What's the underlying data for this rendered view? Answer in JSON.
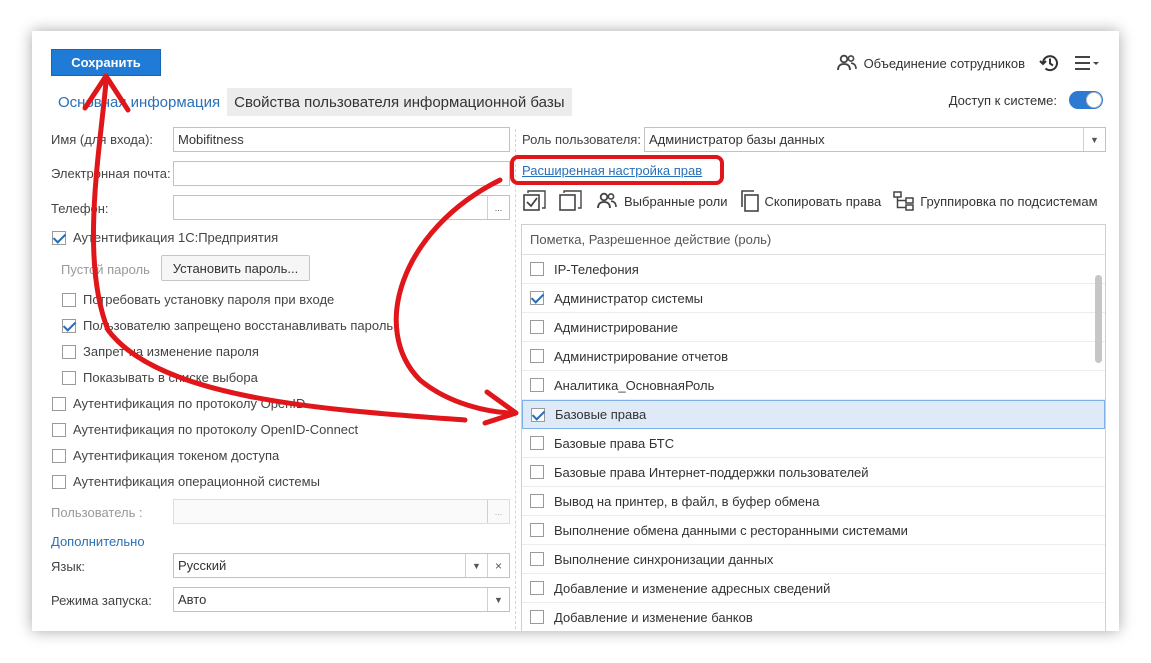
{
  "header": {
    "save_label": "Сохранить",
    "merge_label": "Объединение сотрудников",
    "merge_icon": "people-icon",
    "history_icon": "history-icon",
    "menu_icon": "hamburger-menu-icon"
  },
  "tabs": [
    {
      "label": "Основная информация",
      "active": false
    },
    {
      "label": "Свойства пользователя информационной базы",
      "active": true
    }
  ],
  "access": {
    "label": "Доступ к системе:",
    "enabled": true
  },
  "form": {
    "login_label": "Имя (для входа):",
    "login_value": "Mobifitness",
    "email_label": "Электронная почта:",
    "email_value": "",
    "phone_label": "Телефон:",
    "phone_value": "",
    "auth1c_label": "Аутентификация 1С:Предприятия",
    "auth1c_checked": true,
    "empty_password_label": "Пустой пароль",
    "set_password_label": "Установить пароль...",
    "require_pw_label": "Потребовать установку пароля при входе",
    "require_pw_checked": false,
    "forbid_restore_label": "Пользователю запрещено восстанавливать пароль",
    "forbid_restore_checked": true,
    "forbid_change_label": "Запрет на изменение пароля",
    "forbid_change_checked": false,
    "show_in_list_label": "Показывать в списке выбора",
    "show_in_list_checked": false,
    "openid_label": "Аутентификация по протоколу OpenID",
    "openid_connect_label": "Аутентификация по протоколу OpenID-Connect",
    "token_label": "Аутентификация токеном доступа",
    "os_label": "Аутентификация операционной системы",
    "os_user_label": "Пользователь   :",
    "os_user_value": "",
    "additional_link": "Дополнительно",
    "language_label": "Язык:",
    "language_value": "Русский",
    "launch_mode_label": "Режима запуска:",
    "launch_mode_value": "Авто",
    "ellipsis": "...",
    "clear": "×"
  },
  "rights": {
    "role_label": "Роль пользователя:",
    "role_value": "Администратор базы данных",
    "advanced_link": "Расширенная настройка прав",
    "toolbar": {
      "check_all_icon": "check-all-icon",
      "copy_list_icon": "uncheck-all-icon",
      "selected_roles_label": "Выбранные роли",
      "copy_rights_label": "Скопировать права",
      "grouping_label": "Группировка по подсистемам"
    },
    "column_header": "Пометка, Разрешенное действие (роль)",
    "items": [
      {
        "label": "IP-Телефония",
        "checked": false
      },
      {
        "label": "Администратор системы",
        "checked": true
      },
      {
        "label": "Администрирование",
        "checked": false
      },
      {
        "label": "Администрирование отчетов",
        "checked": false
      },
      {
        "label": "Аналитика_ОсновнаяРоль",
        "checked": false
      },
      {
        "label": "Базовые права",
        "checked": true
      },
      {
        "label": "Базовые права БТС",
        "checked": false
      },
      {
        "label": "Базовые права Интернет-поддержки пользователей",
        "checked": false
      },
      {
        "label": "Вывод на принтер, в файл, в буфер обмена",
        "checked": false
      },
      {
        "label": "Выполнение обмена данными с ресторанными системами",
        "checked": false
      },
      {
        "label": "Выполнение синхронизации данных",
        "checked": false
      },
      {
        "label": "Добавление и изменение адресных сведений",
        "checked": false
      },
      {
        "label": "Добавление и изменение банков",
        "checked": false
      }
    ],
    "selected_index": 5
  },
  "colors": {
    "primary": "#1f7bd6",
    "link": "#2870b8",
    "annotation": "#e0161b",
    "selection": "#dfeaf8"
  }
}
